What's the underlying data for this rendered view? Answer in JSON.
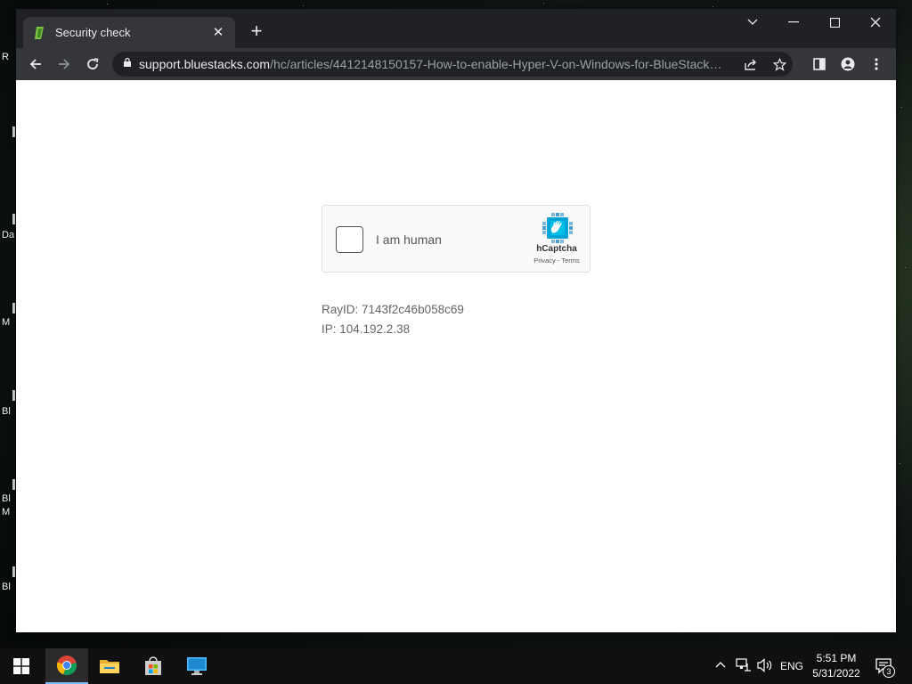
{
  "desktop": {
    "fragments": [
      "R",
      "Da",
      "M",
      "Bl",
      "Bl",
      "M",
      "Bl"
    ]
  },
  "browser": {
    "tab": {
      "title": "Security check",
      "favicon": "bluestacks-favicon-icon"
    },
    "url": {
      "host": "support.bluestacks.com",
      "path": "/hc/articles/4412148150157-How-to-enable-Hyper-V-on-Windows-for-BlueStacks-..."
    }
  },
  "page": {
    "captcha": {
      "label": "I am human",
      "brand": "hCaptcha",
      "privacy": "Privacy",
      "separator": " - ",
      "terms": "Terms"
    },
    "ray_id": "RayID: 7143f2c46b058c69",
    "ip": "IP: 104.192.2.38"
  },
  "taskbar": {
    "language": "ENG",
    "time": "5:51 PM",
    "date": "5/31/2022",
    "notification_count": "3"
  }
}
